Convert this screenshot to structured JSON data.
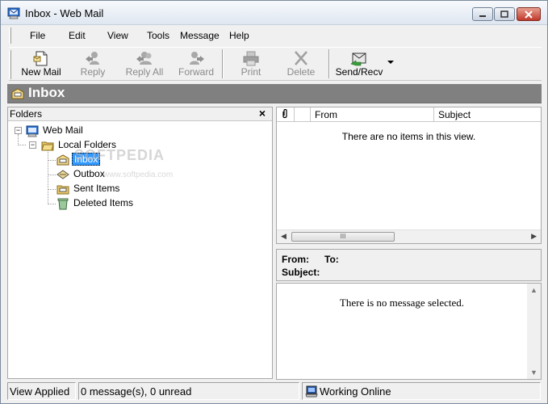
{
  "window": {
    "title": "Inbox - Web Mail"
  },
  "menu": {
    "items": [
      "File",
      "Edit",
      "View",
      "Tools",
      "Message",
      "Help"
    ]
  },
  "toolbar": {
    "buttons": [
      {
        "label": "New Mail",
        "icon": "new-mail-icon",
        "enabled": true
      },
      {
        "label": "Reply",
        "icon": "reply-icon",
        "enabled": false
      },
      {
        "label": "Reply All",
        "icon": "reply-all-icon",
        "enabled": false
      },
      {
        "label": "Forward",
        "icon": "forward-icon",
        "enabled": false
      },
      {
        "label": "Print",
        "icon": "print-icon",
        "enabled": false
      },
      {
        "label": "Delete",
        "icon": "delete-icon",
        "enabled": false
      },
      {
        "label": "Send/Recv",
        "icon": "send-receive-icon",
        "enabled": true
      }
    ]
  },
  "folder_bar": {
    "title": "Inbox"
  },
  "folders": {
    "header": "Folders",
    "close": "×",
    "tree": [
      {
        "label": "Web Mail",
        "icon": "web-mail-icon",
        "expander": "−"
      },
      {
        "label": "Local Folders",
        "icon": "local-folders-icon",
        "expander": "−"
      },
      {
        "label": "Inbox",
        "icon": "inbox-icon",
        "selected": true
      },
      {
        "label": "Outbox",
        "icon": "outbox-icon"
      },
      {
        "label": "Sent Items",
        "icon": "sent-items-icon"
      },
      {
        "label": "Deleted Items",
        "icon": "deleted-items-icon"
      }
    ],
    "watermark": "SOFTPEDIA",
    "watermark_sub": "www.softpedia.com"
  },
  "message_list": {
    "columns": [
      "From",
      "Subject"
    ],
    "empty_text": "There are no items in this view.",
    "scroll_thumb": "III"
  },
  "preview": {
    "from_label": "From:",
    "to_label": "To:",
    "subject_label": "Subject:",
    "empty_text": "There is no message selected."
  },
  "status": {
    "view": "View Applied",
    "messages": "0 message(s), 0 unread",
    "connection": "Working Online"
  },
  "colors": {
    "folder_bar_bg": "#808080",
    "selection": "#3399ff"
  }
}
